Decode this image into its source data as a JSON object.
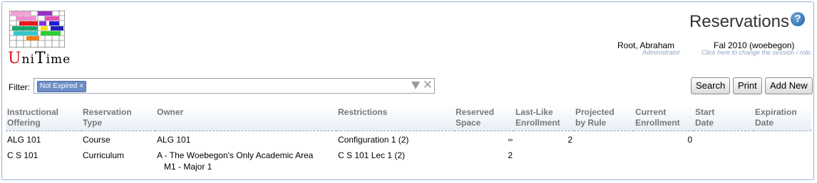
{
  "logo": {
    "first": "U",
    "mid": "ni",
    "t": "T",
    "last": "ime"
  },
  "header": {
    "title": "Reservations",
    "help_icon": "?",
    "user": {
      "name": "Root, Abraham",
      "role": "Administrator"
    },
    "session": {
      "name": "Fal 2010 (woebegon)",
      "hint": "Click here to change the session / role."
    }
  },
  "filter": {
    "label": "Filter:",
    "chip": "Not Expired",
    "chip_remove": "×",
    "clear_icon": "✕"
  },
  "buttons": {
    "search": "Search",
    "print": "Print",
    "add_new": "Add New"
  },
  "table": {
    "headers": {
      "offering": [
        "Instructional",
        "Offering"
      ],
      "type": [
        "Reservation",
        "Type"
      ],
      "owner": [
        "Owner"
      ],
      "restrictions": [
        "Restrictions"
      ],
      "reserved": [
        "Reserved",
        "Space"
      ],
      "last_like": [
        "Last-Like",
        "Enrollment"
      ],
      "projected": [
        "Projected",
        "by Rule"
      ],
      "current": [
        "Current",
        "Enrollment"
      ],
      "start": [
        "Start",
        "Date"
      ],
      "expiration": [
        "Expiration",
        "Date"
      ]
    },
    "rows": [
      {
        "offering": "ALG 101",
        "type": "Course",
        "owner": "ALG 101",
        "owner2": "",
        "restrictions": "Configuration 1 (2)",
        "reserved": "∞",
        "last_like": "2",
        "projected": "",
        "current": "0",
        "start": "",
        "expiration": ""
      },
      {
        "offering": "C S 101",
        "type": "Curriculum",
        "owner": "A - The Woebegon's Only Academic Area",
        "owner2": "M1 - Major 1",
        "restrictions": "C S 101 Lec 1 (2)",
        "reserved": "2",
        "last_like": "",
        "projected": "",
        "current": "",
        "start": "",
        "expiration": ""
      }
    ]
  },
  "colors": {
    "accent": "#6e8ec8",
    "logo_red": "#d4151a",
    "hint": "#8ea4c2",
    "header_text": "#777777"
  }
}
